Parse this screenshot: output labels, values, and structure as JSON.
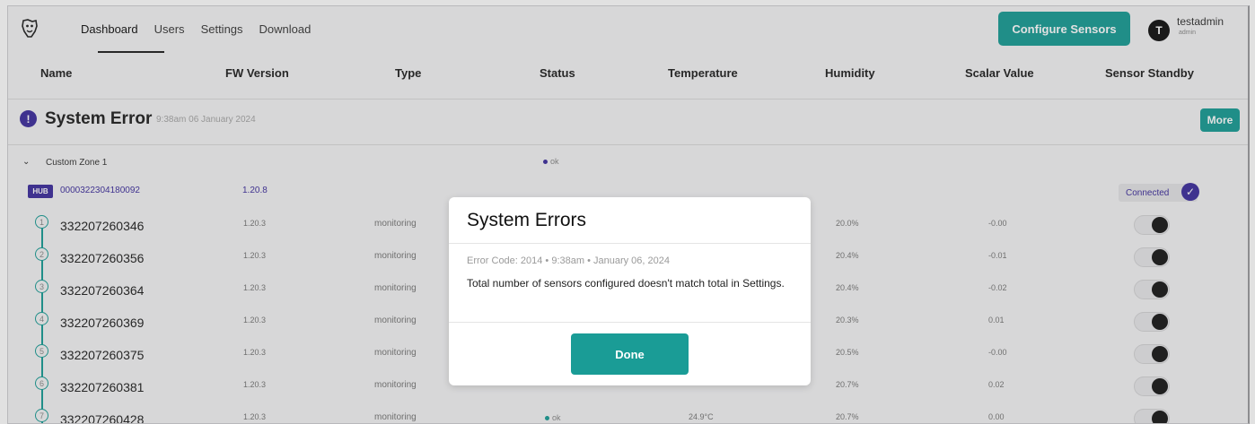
{
  "nav": {
    "tabs": [
      "Dashboard",
      "Users",
      "Settings",
      "Download"
    ],
    "active_tab": "Dashboard",
    "configure_button": "Configure Sensors",
    "user": {
      "initial": "T",
      "name": "testadmin",
      "role": "admin"
    }
  },
  "columns": [
    "Name",
    "FW Version",
    "Type",
    "Status",
    "Temperature",
    "Humidity",
    "Scalar Value",
    "Sensor Standby"
  ],
  "system_error": {
    "title": "System Error",
    "timestamp": "9:38am 06 January 2024",
    "more_label": "More"
  },
  "zone": {
    "name": "Custom Zone 1",
    "status": "ok",
    "hub": {
      "badge": "HUB",
      "id": "0000322304180092",
      "fw": "1.20.8",
      "connection": "Connected"
    }
  },
  "sensors": [
    {
      "num": "1",
      "id": "332207260346",
      "fw": "1.20.3",
      "type": "monitoring",
      "status": "",
      "temperature": "",
      "humidity": "20.0%",
      "scalar": "-0.00"
    },
    {
      "num": "2",
      "id": "332207260356",
      "fw": "1.20.3",
      "type": "monitoring",
      "status": "",
      "temperature": "",
      "humidity": "20.4%",
      "scalar": "-0.01"
    },
    {
      "num": "3",
      "id": "332207260364",
      "fw": "1.20.3",
      "type": "monitoring",
      "status": "",
      "temperature": "",
      "humidity": "20.4%",
      "scalar": "-0.02"
    },
    {
      "num": "4",
      "id": "332207260369",
      "fw": "1.20.3",
      "type": "monitoring",
      "status": "",
      "temperature": "",
      "humidity": "20.3%",
      "scalar": "0.01"
    },
    {
      "num": "5",
      "id": "332207260375",
      "fw": "1.20.3",
      "type": "monitoring",
      "status": "",
      "temperature": "",
      "humidity": "20.5%",
      "scalar": "-0.00"
    },
    {
      "num": "6",
      "id": "332207260381",
      "fw": "1.20.3",
      "type": "monitoring",
      "status": "",
      "temperature": "",
      "humidity": "20.7%",
      "scalar": "0.02"
    },
    {
      "num": "7",
      "id": "332207260428",
      "fw": "1.20.3",
      "type": "monitoring",
      "status": "ok",
      "temperature": "24.9°C",
      "humidity": "20.7%",
      "scalar": "0.00"
    }
  ],
  "modal": {
    "title": "System Errors",
    "error_code": "Error Code: 2014 • 9:38am • January 06, 2024",
    "message": "Total number of sensors configured doesn't match total in Settings.",
    "done_label": "Done"
  },
  "colors": {
    "accent": "#1a9c96",
    "brand": "#3f2f9e",
    "status_ok": "#1a9c96"
  }
}
